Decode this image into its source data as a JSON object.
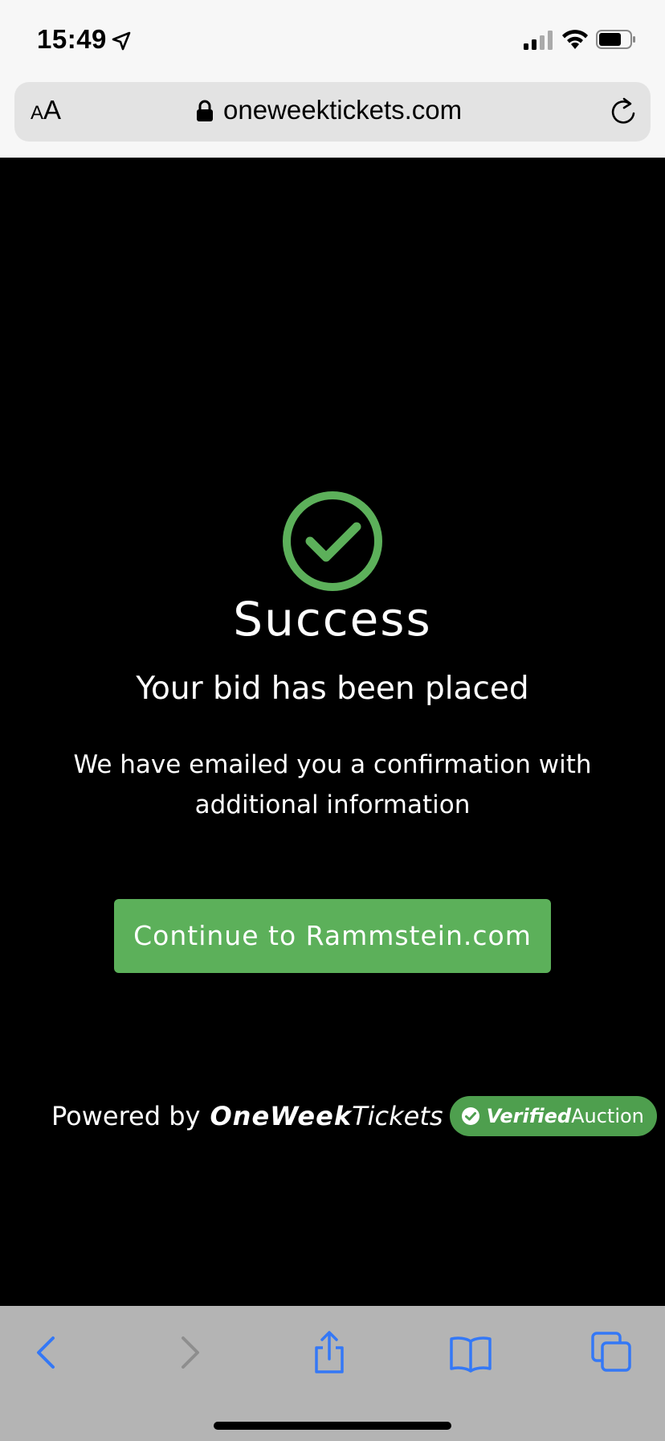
{
  "status_bar": {
    "time": "15:49",
    "icons": [
      "location-arrow-icon",
      "signal-icon",
      "wifi-icon",
      "battery-icon"
    ]
  },
  "browser": {
    "text_size_label_small": "A",
    "text_size_label_big": "A",
    "url": "oneweektickets.com",
    "icons": [
      "lock-icon",
      "reload-icon"
    ]
  },
  "page": {
    "success_title": "Success",
    "bid_message": "Your bid has been placed",
    "info_message": "We have emailed you a confirmation with additional information",
    "continue_label": "Continue to Rammstein.com",
    "powered_by": "Powered by",
    "brand_bold": "OneWeek",
    "brand_light": "Tickets",
    "badge_verified": "Verified",
    "badge_auction": "Auction"
  },
  "toolbar": {
    "icons": [
      "back-icon",
      "forward-icon",
      "share-icon",
      "bookmarks-icon",
      "tabs-icon"
    ]
  },
  "colors": {
    "accent_green": "#5cb05a",
    "badge_green": "#4e9f4e",
    "toolbar_blue": "#3478f6",
    "background": "#000000"
  }
}
